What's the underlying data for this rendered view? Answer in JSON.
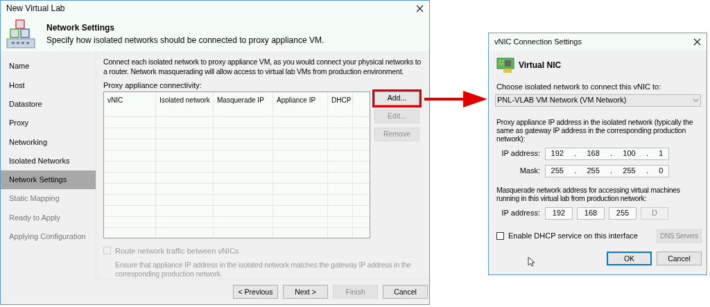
{
  "wizard": {
    "title": "New Virtual Lab",
    "header": {
      "title": "Network Settings",
      "subtitle": "Specify how isolated networks should be connected to proxy appliance VM."
    },
    "steps": [
      {
        "label": "Name",
        "selected": false,
        "disabled": false
      },
      {
        "label": "Host",
        "selected": false,
        "disabled": false
      },
      {
        "label": "Datastore",
        "selected": false,
        "disabled": false
      },
      {
        "label": "Proxy",
        "selected": false,
        "disabled": false
      },
      {
        "label": "Networking",
        "selected": false,
        "disabled": false
      },
      {
        "label": "Isolated Networks",
        "selected": false,
        "disabled": false
      },
      {
        "label": "Network Settings",
        "selected": true,
        "disabled": false
      },
      {
        "label": "Static Mapping",
        "selected": false,
        "disabled": true
      },
      {
        "label": "Ready to Apply",
        "selected": false,
        "disabled": true
      },
      {
        "label": "Applying Configuration",
        "selected": false,
        "disabled": true
      }
    ],
    "intro": "Connect each isolated network to proxy appliance VM, as you would connect your physical networks to a router. Network masquerading will allow access to virtual lab VMs from production environment.",
    "table_label": "Proxy appliance connectivity:",
    "table": {
      "columns": [
        "vNIC",
        "Isolated network",
        "Masquerade IP",
        "Appliance IP",
        "DHCP"
      ]
    },
    "side_buttons": [
      {
        "label": "Add...",
        "disabled": false,
        "highlighted": true
      },
      {
        "label": "Edit...",
        "disabled": true,
        "highlighted": false
      },
      {
        "label": "Remove",
        "disabled": true,
        "highlighted": false
      }
    ],
    "route_option": {
      "label": "Route network traffic between vNICs",
      "checked": false,
      "disabled": true
    },
    "route_hint": "Ensure that appliance IP address in the isolated network matches the gateway IP address in the corresponding production network.",
    "footer_buttons": [
      {
        "label": "< Previous",
        "disabled": false
      },
      {
        "label": "Next >",
        "disabled": false
      },
      {
        "label": "Finish",
        "disabled": true
      },
      {
        "label": "Cancel",
        "disabled": false
      }
    ]
  },
  "dialog": {
    "title": "vNIC Connection Settings",
    "heading": "Virtual NIC",
    "network_label": "Choose isolated network to connect this vNIC to:",
    "network_value": "PNL-VLAB VM Network (VM Network)",
    "proxy_text": "Proxy appliance IP address in the isolated network (typically the same as gateway IP address in the corresponding production network):",
    "proxy_fields": [
      {
        "label": "IP address:",
        "separator": ".",
        "octets": [
          "192",
          "168",
          "100",
          "1"
        ]
      },
      {
        "label": "Mask:",
        "separator": ".",
        "octets": [
          "255",
          "255",
          "255",
          "0"
        ]
      }
    ],
    "masquerade_text": "Masquerade network address for accessing virtual machines running in this virtual lab from production network:",
    "masquerade_field": {
      "label": "IP address:",
      "octets": [
        {
          "value": "192",
          "disabled": false
        },
        {
          "value": "168",
          "disabled": false
        },
        {
          "value": "255",
          "disabled": false
        },
        {
          "value": "D",
          "disabled": true
        }
      ]
    },
    "dhcp_option": {
      "label": "Enable DHCP service on this interface",
      "checked": false
    },
    "dns_button": {
      "label": "DNS Servers",
      "disabled": true
    },
    "buttons": [
      {
        "label": "OK",
        "default": true
      },
      {
        "label": "Cancel",
        "default": false
      }
    ]
  }
}
